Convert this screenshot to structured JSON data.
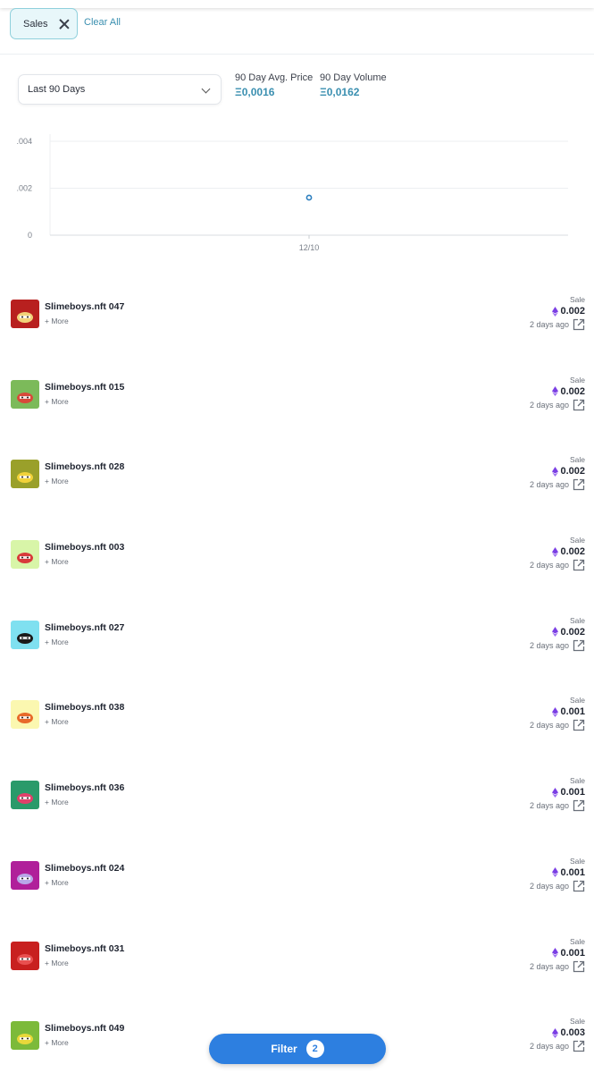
{
  "filters": {
    "chip_label": "Sales",
    "clear_all": "Clear All"
  },
  "period_select": {
    "value": "Last 90 Days"
  },
  "stats": [
    {
      "label": "90 Day Avg. Price",
      "value": "Ξ0,0016"
    },
    {
      "label": "90 Day Volume",
      "value": "Ξ0,0162"
    }
  ],
  "chart_data": {
    "type": "scatter",
    "x": [
      "12/10"
    ],
    "y": [
      0.0016
    ],
    "yticks": [
      ".004",
      ".002",
      "0"
    ],
    "ylim": [
      0,
      0.004
    ],
    "grid": true,
    "xlabel": "",
    "ylabel": ""
  },
  "sales": [
    {
      "name": "Slimeboys.nft 047",
      "more": "+ More",
      "kind": "Sale",
      "price": "0.002",
      "time": "2 days ago",
      "bg": "#b8201f",
      "fg": "#f2d27a"
    },
    {
      "name": "Slimeboys.nft 015",
      "more": "+ More",
      "kind": "Sale",
      "price": "0.002",
      "time": "2 days ago",
      "bg": "#7cba5a",
      "fg": "#d84a3a"
    },
    {
      "name": "Slimeboys.nft 028",
      "more": "+ More",
      "kind": "Sale",
      "price": "0.002",
      "time": "2 days ago",
      "bg": "#9aa02a",
      "fg": "#f2d23a"
    },
    {
      "name": "Slimeboys.nft 003",
      "more": "+ More",
      "kind": "Sale",
      "price": "0.002",
      "time": "2 days ago",
      "bg": "#d8f5a8",
      "fg": "#d83a3a"
    },
    {
      "name": "Slimeboys.nft 027",
      "more": "+ More",
      "kind": "Sale",
      "price": "0.002",
      "time": "2 days ago",
      "bg": "#7fe0f0",
      "fg": "#1a1a1a"
    },
    {
      "name": "Slimeboys.nft 038",
      "more": "+ More",
      "kind": "Sale",
      "price": "0.001",
      "time": "2 days ago",
      "bg": "#fbf7b0",
      "fg": "#e86a2a"
    },
    {
      "name": "Slimeboys.nft 036",
      "more": "+ More",
      "kind": "Sale",
      "price": "0.001",
      "time": "2 days ago",
      "bg": "#2a9a6a",
      "fg": "#e0406a"
    },
    {
      "name": "Slimeboys.nft 024",
      "more": "+ More",
      "kind": "Sale",
      "price": "0.001",
      "time": "2 days ago",
      "bg": "#b0209a",
      "fg": "#b8a8e8"
    },
    {
      "name": "Slimeboys.nft 031",
      "more": "+ More",
      "kind": "Sale",
      "price": "0.001",
      "time": "2 days ago",
      "bg": "#c8201f",
      "fg": "#e85050"
    },
    {
      "name": "Slimeboys.nft 049",
      "more": "+ More",
      "kind": "Sale",
      "price": "0.003",
      "time": "2 days ago",
      "bg": "#7cba3a",
      "fg": "#e8d83a"
    }
  ],
  "filter_button": {
    "label": "Filter",
    "count": "2"
  },
  "colors": {
    "accent": "#3a8fb0",
    "primary_button": "#2d7fe0",
    "eth_icon": "#7b3fe4"
  }
}
